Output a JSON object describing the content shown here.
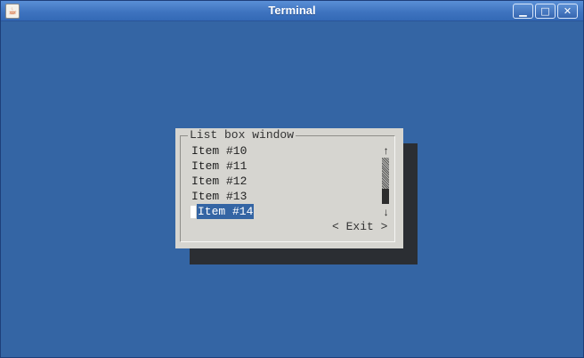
{
  "window": {
    "title": "Terminal",
    "icon": "java-cup-icon",
    "controls": {
      "minimize": "▁",
      "maximize": "□",
      "close": "✕"
    }
  },
  "dialog": {
    "title": "List box window",
    "items": [
      "Item #10",
      "Item #11",
      "Item #12",
      "Item #13",
      "Item #14"
    ],
    "selected_index": 4,
    "scroll_up": "↑",
    "scroll_down": "↓",
    "exit_label": "< Exit >"
  },
  "colors": {
    "background": "#3465a4",
    "dialog": "#d6d5d0",
    "selection": "#3465a4",
    "shadow": "#2b2e33"
  }
}
